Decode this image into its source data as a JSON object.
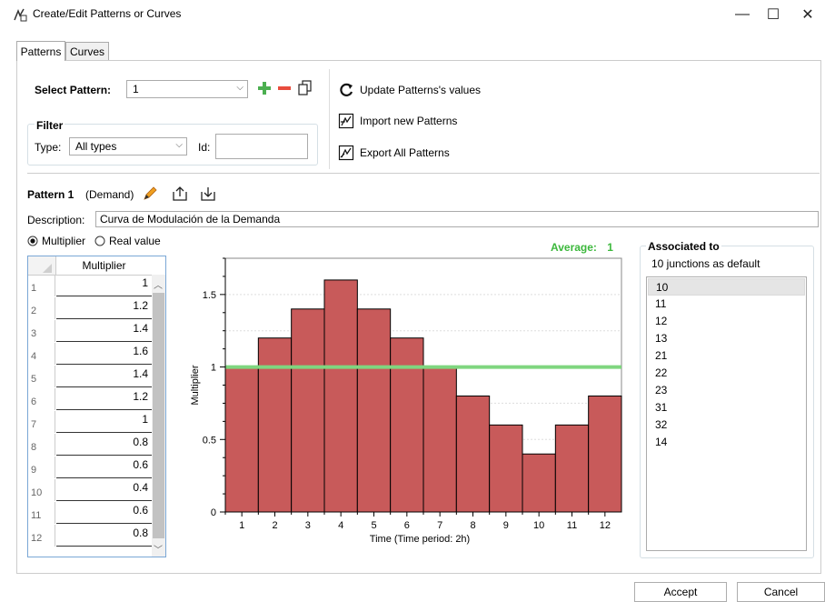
{
  "window": {
    "title": "Create/Edit Patterns or Curves",
    "minimize": "—",
    "maximize": "☐",
    "close": "✕"
  },
  "tabs": [
    {
      "label": "Patterns",
      "active": true
    },
    {
      "label": "Curves",
      "active": false
    }
  ],
  "select_pattern": {
    "label": "Select Pattern:",
    "value": "1"
  },
  "filter": {
    "group_label": "Filter",
    "type_label": "Type:",
    "type_value": "All types",
    "id_label": "Id:",
    "id_value": ""
  },
  "actions": {
    "update": "Update Patterns's values",
    "import": "Import new Patterns",
    "export": "Export All Patterns"
  },
  "pattern": {
    "name": "Pattern 1",
    "category": "(Demand)"
  },
  "description": {
    "label": "Description:",
    "value": "Curva de Modulación de la Demanda"
  },
  "mode": {
    "multiplier": "Multiplier",
    "real_value": "Real value",
    "selected": "multiplier"
  },
  "table": {
    "header": "Multiplier",
    "rows": [
      {
        "n": "1",
        "v": "1"
      },
      {
        "n": "2",
        "v": "1.2"
      },
      {
        "n": "3",
        "v": "1.4"
      },
      {
        "n": "4",
        "v": "1.6"
      },
      {
        "n": "5",
        "v": "1.4"
      },
      {
        "n": "6",
        "v": "1.2"
      },
      {
        "n": "7",
        "v": "1"
      },
      {
        "n": "8",
        "v": "0.8"
      },
      {
        "n": "9",
        "v": "0.6"
      },
      {
        "n": "10",
        "v": "0.4"
      },
      {
        "n": "11",
        "v": "0.6"
      },
      {
        "n": "12",
        "v": "0.8"
      }
    ]
  },
  "average": {
    "label": "Average:",
    "value": "1"
  },
  "chart_data": {
    "type": "bar",
    "categories": [
      "1",
      "2",
      "3",
      "4",
      "5",
      "6",
      "7",
      "8",
      "9",
      "10",
      "11",
      "12"
    ],
    "values": [
      1,
      1.2,
      1.4,
      1.6,
      1.4,
      1.2,
      1,
      0.8,
      0.6,
      0.4,
      0.6,
      0.8
    ],
    "xlabel": "Time (Time period: 2h)",
    "ylabel": "Multiplier",
    "ylim": [
      0,
      1.75
    ],
    "yticks": [
      "0",
      "0.5",
      "1",
      "1.5"
    ],
    "average_line": 1,
    "colors": {
      "bar": "#c85a5a",
      "bar_edge": "#000000",
      "average": "#7fd67f"
    },
    "grid": "horizontal dotted"
  },
  "associated": {
    "label": "Associated to",
    "default_text": "10 junctions as default",
    "items": [
      "10",
      "11",
      "12",
      "13",
      "21",
      "22",
      "23",
      "31",
      "32",
      "14"
    ],
    "selected_index": 0
  },
  "buttons": {
    "accept": "Accept",
    "cancel": "Cancel"
  }
}
